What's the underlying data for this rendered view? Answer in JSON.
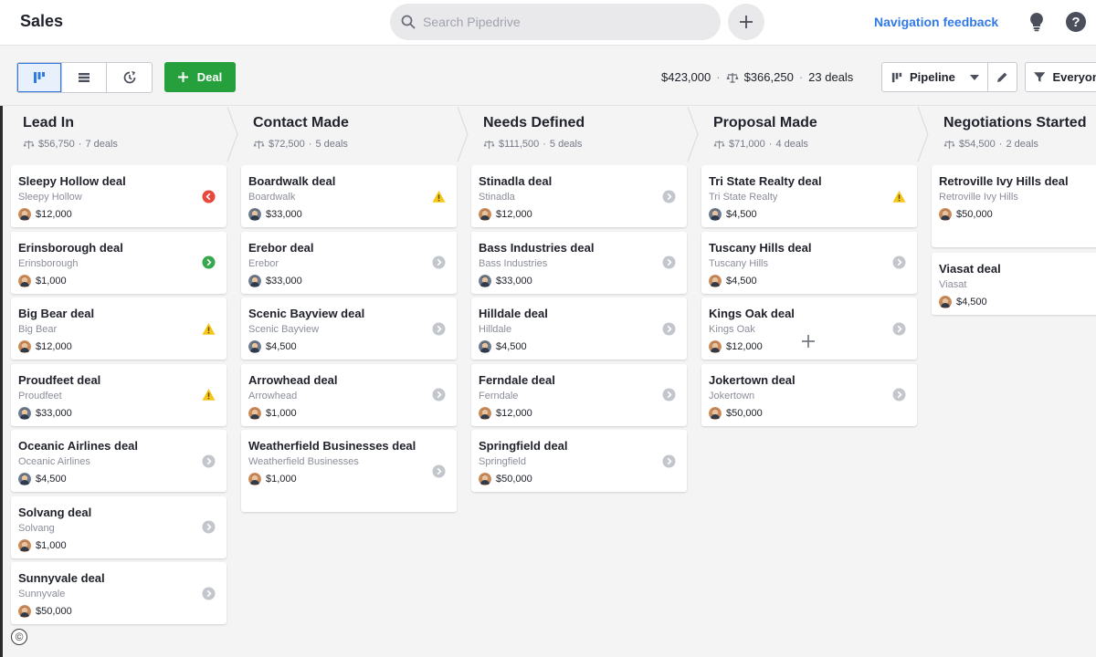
{
  "header": {
    "app_title": "Sales",
    "search_placeholder": "Search Pipedrive",
    "nav_feedback": "Navigation feedback"
  },
  "toolbar": {
    "add_deal_label": "Deal",
    "total_value": "$423,000",
    "weighted_value": "$366,250",
    "deal_count": "23 deals",
    "pipeline_label": "Pipeline",
    "filter_label": "Everyone"
  },
  "colors": {
    "accent_blue": "#317ae2",
    "add_green": "#26a03d",
    "overdue_red": "#e8473c",
    "scheduled_green": "#36a84f",
    "warning_yellow": "#f5c518",
    "neutral_gray": "#c3c6cd"
  },
  "stages": [
    {
      "name": "Lead In",
      "weighted": "$56,750",
      "count": "7 deals",
      "deals": [
        {
          "title": "Sleepy Hollow deal",
          "org": "Sleepy Hollow",
          "value": "$12,000",
          "status": "overdue",
          "avatar": "woman-avatar"
        },
        {
          "title": "Erinsborough deal",
          "org": "Erinsborough",
          "value": "$1,000",
          "status": "scheduled",
          "avatar": "woman-avatar"
        },
        {
          "title": "Big Bear deal",
          "org": "Big Bear",
          "value": "$12,000",
          "status": "warning",
          "avatar": "woman-avatar"
        },
        {
          "title": "Proudfeet deal",
          "org": "Proudfeet",
          "value": "$33,000",
          "status": "warning",
          "avatar": "man-avatar"
        },
        {
          "title": "Oceanic Airlines deal",
          "org": "Oceanic Airlines",
          "value": "$4,500",
          "status": "none",
          "avatar": "man-avatar"
        },
        {
          "title": "Solvang deal",
          "org": "Solvang",
          "value": "$1,000",
          "status": "none",
          "avatar": "woman-avatar"
        },
        {
          "title": "Sunnyvale deal",
          "org": "Sunnyvale",
          "value": "$50,000",
          "status": "none",
          "avatar": "woman-avatar"
        }
      ]
    },
    {
      "name": "Contact Made",
      "weighted": "$72,500",
      "count": "5 deals",
      "deals": [
        {
          "title": "Boardwalk deal",
          "org": "Boardwalk",
          "value": "$33,000",
          "status": "warning",
          "avatar": "man-avatar"
        },
        {
          "title": "Erebor deal",
          "org": "Erebor",
          "value": "$33,000",
          "status": "none",
          "avatar": "man-avatar"
        },
        {
          "title": "Scenic Bayview deal",
          "org": "Scenic Bayview",
          "value": "$4,500",
          "status": "none",
          "avatar": "man-avatar"
        },
        {
          "title": "Arrowhead deal",
          "org": "Arrowhead",
          "value": "$1,000",
          "status": "none",
          "avatar": "woman-avatar"
        },
        {
          "title": "Weatherfield Businesses deal",
          "org": "Weatherfield Businesses",
          "value": "$1,000",
          "status": "none",
          "avatar": "woman-avatar"
        }
      ]
    },
    {
      "name": "Needs Defined",
      "weighted": "$111,500",
      "count": "5 deals",
      "deals": [
        {
          "title": "Stinadla deal",
          "org": "Stinadla",
          "value": "$12,000",
          "status": "none",
          "avatar": "woman-avatar"
        },
        {
          "title": "Bass Industries deal",
          "org": "Bass Industries",
          "value": "$33,000",
          "status": "none",
          "avatar": "man-avatar"
        },
        {
          "title": "Hilldale deal",
          "org": "Hilldale",
          "value": "$4,500",
          "status": "none",
          "avatar": "man-avatar"
        },
        {
          "title": "Ferndale deal",
          "org": "Ferndale",
          "value": "$12,000",
          "status": "none",
          "avatar": "woman-avatar"
        },
        {
          "title": "Springfield deal",
          "org": "Springfield",
          "value": "$50,000",
          "status": "none",
          "avatar": "woman-avatar"
        }
      ]
    },
    {
      "name": "Proposal Made",
      "weighted": "$71,000",
      "count": "4 deals",
      "deals": [
        {
          "title": "Tri State Realty deal",
          "org": "Tri State Realty",
          "value": "$4,500",
          "status": "warning",
          "avatar": "man-avatar"
        },
        {
          "title": "Tuscany Hills deal",
          "org": "Tuscany Hills",
          "value": "$4,500",
          "status": "none",
          "avatar": "woman-avatar"
        },
        {
          "title": "Kings Oak deal",
          "org": "Kings Oak",
          "value": "$12,000",
          "status": "none",
          "avatar": "woman-avatar"
        },
        {
          "title": "Jokertown deal",
          "org": "Jokertown",
          "value": "$50,000",
          "status": "none",
          "avatar": "woman-avatar"
        }
      ]
    },
    {
      "name": "Negotiations Started",
      "weighted": "$54,500",
      "count": "2 deals",
      "deals": [
        {
          "title": "Retroville Ivy Hills deal",
          "org": "Retroville Ivy Hills",
          "value": "$50,000",
          "status": "none",
          "avatar": "woman-avatar"
        },
        {
          "title": "Viasat deal",
          "org": "Viasat",
          "value": "$4,500",
          "status": "none",
          "avatar": "woman-avatar"
        }
      ]
    }
  ]
}
